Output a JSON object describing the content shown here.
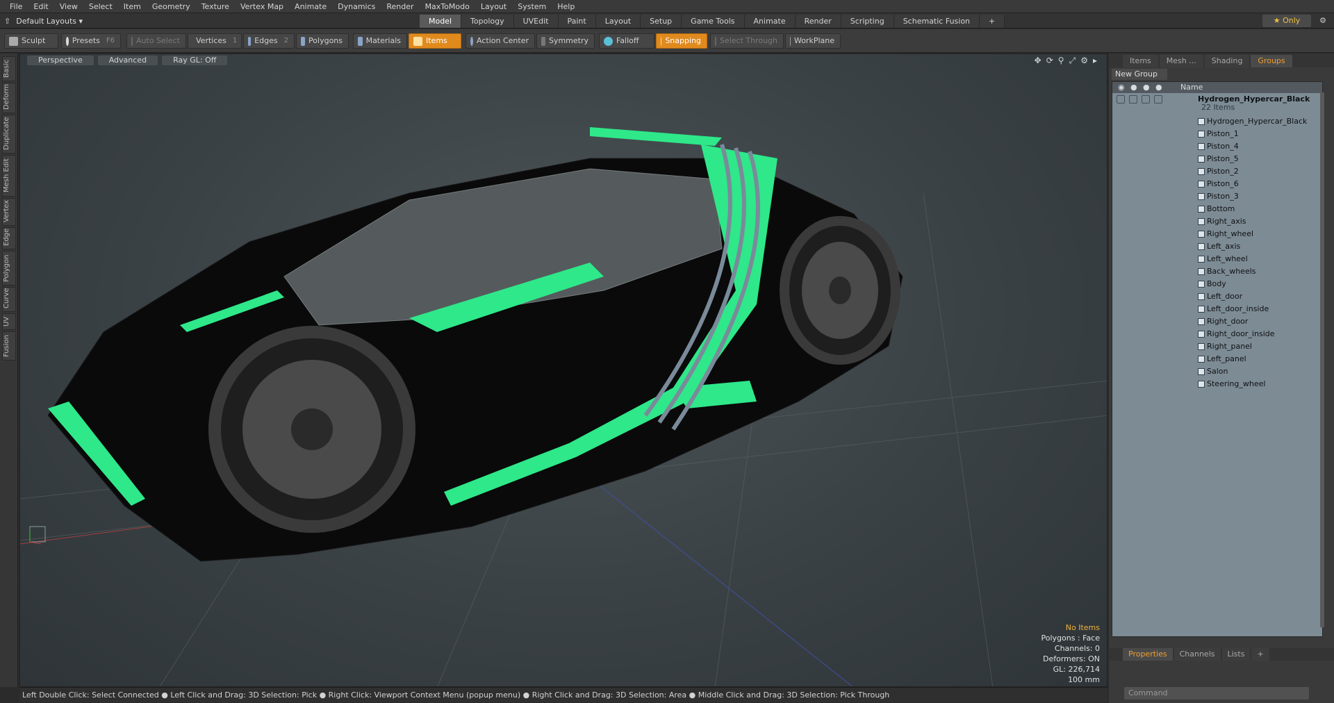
{
  "menu": [
    "File",
    "Edit",
    "View",
    "Select",
    "Item",
    "Geometry",
    "Texture",
    "Vertex Map",
    "Animate",
    "Dynamics",
    "Render",
    "MaxToModo",
    "Layout",
    "System",
    "Help"
  ],
  "layout_select": "Default Layouts ▾",
  "tabs": [
    "Model",
    "Topology",
    "UVEdit",
    "Paint",
    "Layout",
    "Setup",
    "Game Tools",
    "Animate",
    "Render",
    "Scripting",
    "Schematic Fusion",
    "+"
  ],
  "only_label": "★ Only",
  "toolbar": {
    "sculpt": "Sculpt",
    "presets": "Presets",
    "presets_key": "F6",
    "auto_select": "Auto Select",
    "vertices": "Vertices",
    "vertices_key": "1",
    "edges": "Edges",
    "edges_key": "2",
    "polygons": "Polygons",
    "materials": "Materials",
    "items": "Items",
    "action_center": "Action Center",
    "symmetry": "Symmetry",
    "falloff": "Falloff",
    "snapping": "Snapping",
    "select_through": "Select Through",
    "workplane": "WorkPlane"
  },
  "left_tabs": [
    "Basic",
    "Deform",
    "Duplicate",
    "Mesh Edit",
    "Vertex",
    "Edge",
    "Polygon",
    "Curve",
    "UV",
    "Fusion"
  ],
  "viewport": {
    "perspective": "Perspective",
    "advanced": "Advanced",
    "raygl": "Ray GL: Off",
    "info": {
      "no_items": "No Items",
      "polygons": "Polygons : Face",
      "channels": "Channels: 0",
      "deformers": "Deformers: ON",
      "gl": "GL: 226,714",
      "scale": "100 mm"
    }
  },
  "status": "Left Double Click: Select Connected ● Left Click and Drag: 3D Selection: Pick ● Right Click: Viewport Context Menu (popup menu) ● Right Click and Drag: 3D Selection: Area ● Middle Click and Drag: 3D Selection: Pick Through",
  "right_panel": {
    "tabs": [
      "Items",
      "Mesh ...",
      "Shading",
      "Groups"
    ],
    "new_group": "New Group",
    "col_name": "Name",
    "root": "Hydrogen_Hypercar_Black",
    "root_count": "22 Items",
    "items": [
      "Hydrogen_Hypercar_Black",
      "Piston_1",
      "Piston_4",
      "Piston_5",
      "Piston_2",
      "Piston_6",
      "Piston_3",
      "Bottom",
      "Right_axis",
      "Right_wheel",
      "Left_axis",
      "Left_wheel",
      "Back_wheels",
      "Body",
      "Left_door",
      "Left_door_inside",
      "Right_door",
      "Right_door_inside",
      "Right_panel",
      "Left_panel",
      "Salon",
      "Steering_wheel"
    ],
    "bottom_tabs": [
      "Properties",
      "Channels",
      "Lists",
      "+"
    ],
    "command_placeholder": "Command"
  },
  "colors": {
    "accent": "#e08a1e",
    "neon": "#2ee88a"
  }
}
